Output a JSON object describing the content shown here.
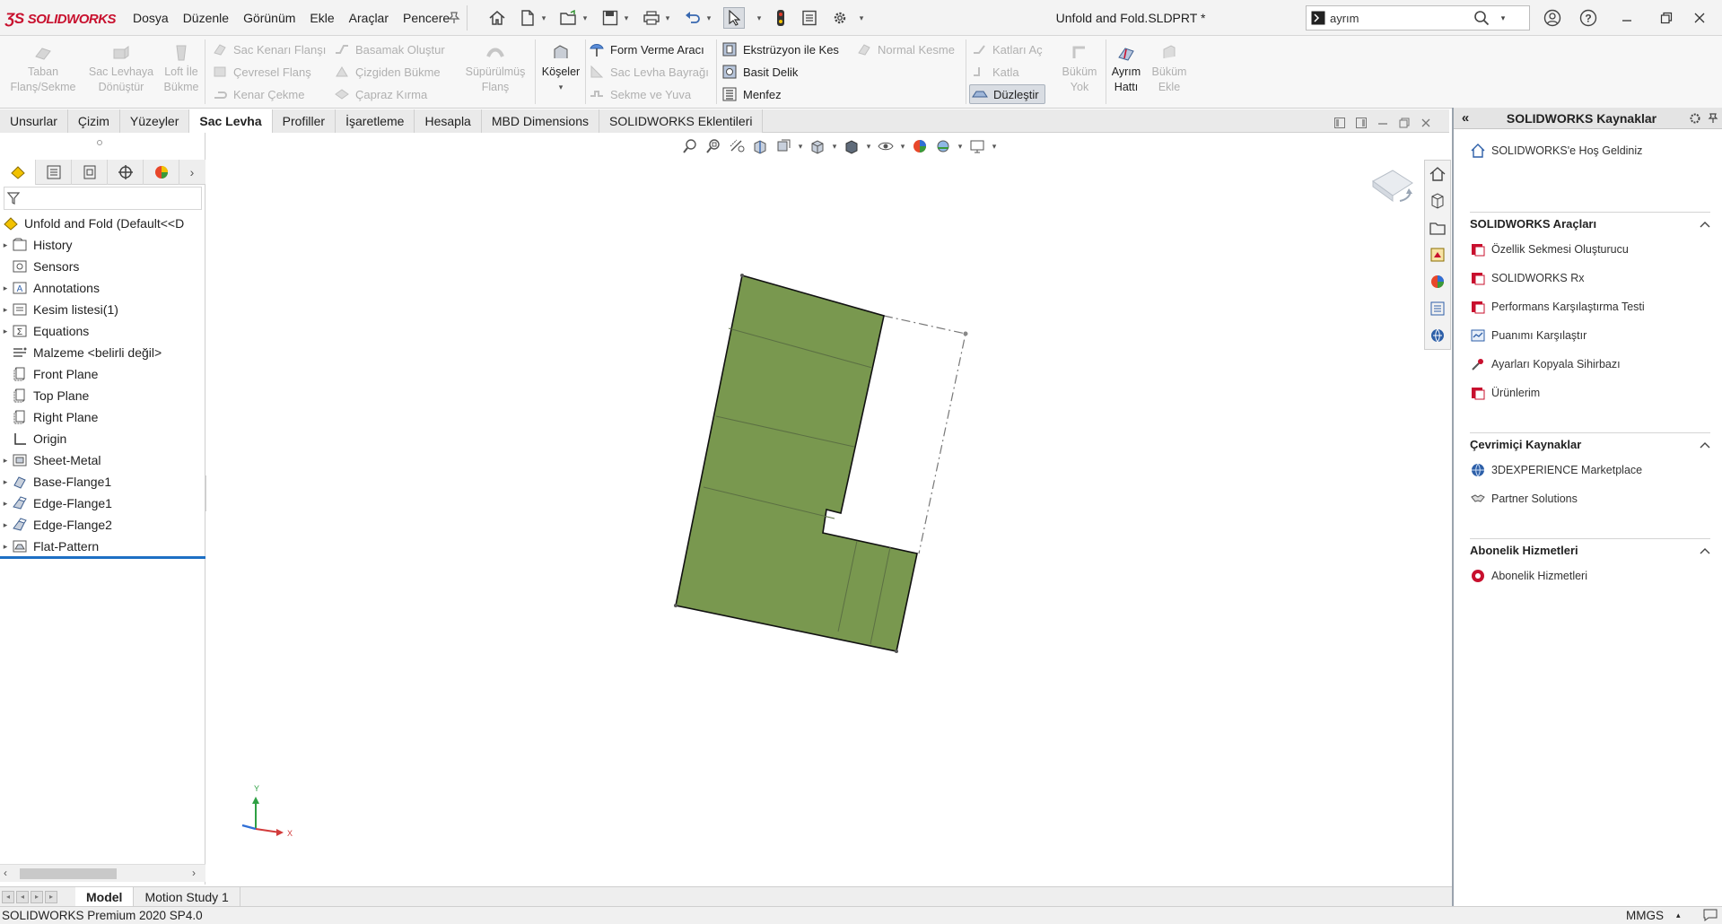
{
  "app": {
    "logo_text": "SOLIDWORKS",
    "brand_color": "#c8102e"
  },
  "menu": [
    "Dosya",
    "Düzenle",
    "Görünüm",
    "Ekle",
    "Araçlar",
    "Pencere"
  ],
  "document": {
    "title": "Unfold and Fold.SLDPRT *"
  },
  "search": {
    "value": "ayrım"
  },
  "ribbon": {
    "taban_flans": "Taban Flanş/Sekme",
    "sac_levhaya_donustur": "Sac Levhaya Dönüştür",
    "loft_ile_bukme": "Loft İle Bükme",
    "sac_kenar_flansi": "Sac Kenarı Flanşı",
    "cevresel_flans": "Çevresel Flanş",
    "kenar_cekme": "Kenar Çekme",
    "basamak_olustur": "Basamak Oluştur",
    "cizgiden_bukme": "Çizgiden Bükme",
    "capraz_kirma": "Çapraz Kırma",
    "supurulmus_flans": "Süpürülmüş Flanş",
    "koseler": "Köşeler",
    "form_verme_araci": "Form Verme Aracı",
    "sac_levha_bayragi": "Sac Levha Bayrağı",
    "sekme_ve_yuva": "Sekme ve Yuva",
    "ekstruzyon_ile_kes": "Ekstrüzyon ile Kes",
    "basit_delik": "Basit Delik",
    "menfez": "Menfez",
    "normal_kesme": "Normal Kesme",
    "katlari_ac": "Katları Aç",
    "katla": "Katla",
    "duzlestir": "Düzleştir",
    "bukum_yok": "Büküm Yok",
    "ayrim_hatti": "Ayrım Hattı",
    "bukum_ekle": "Büküm Ekle"
  },
  "tabs": [
    "Unsurlar",
    "Çizim",
    "Yüzeyler",
    "Sac Levha",
    "Profiller",
    "İşaretleme",
    "Hesapla",
    "MBD Dimensions",
    "SOLIDWORKS Eklentileri"
  ],
  "tree": {
    "root": "Unfold and Fold  (Default<<D",
    "items": [
      "History",
      "Sensors",
      "Annotations",
      "Kesim listesi(1)",
      "Equations",
      "Malzeme <belirli değil>",
      "Front Plane",
      "Top Plane",
      "Right Plane",
      "Origin",
      "Sheet-Metal",
      "Base-Flange1",
      "Edge-Flange1",
      "Edge-Flange2",
      "Flat-Pattern"
    ]
  },
  "graphics": {
    "part_color": "#79984f",
    "triad_x": "X",
    "triad_y": "Y"
  },
  "taskpane": {
    "title": "SOLIDWORKS Kaynaklar",
    "welcome": "SOLIDWORKS'e Hoş Geldiniz",
    "tools_header": "SOLIDWORKS Araçları",
    "tools": [
      "Özellik Sekmesi Oluşturucu",
      "SOLIDWORKS Rx",
      "Performans Karşılaştırma Testi",
      "Puanımı Karşılaştır",
      "Ayarları Kopyala Sihirbazı",
      "Ürünlerim"
    ],
    "online_header": "Çevrimiçi Kaynaklar",
    "online": [
      "3DEXPERIENCE Marketplace",
      "Partner Solutions"
    ],
    "sub_header": "Abonelik Hizmetleri",
    "sub": [
      "Abonelik Hizmetleri"
    ]
  },
  "bottom_tabs": [
    "Model",
    "Motion Study 1"
  ],
  "status": {
    "product": "SOLIDWORKS Premium 2020 SP4.0",
    "units": "MMGS"
  }
}
